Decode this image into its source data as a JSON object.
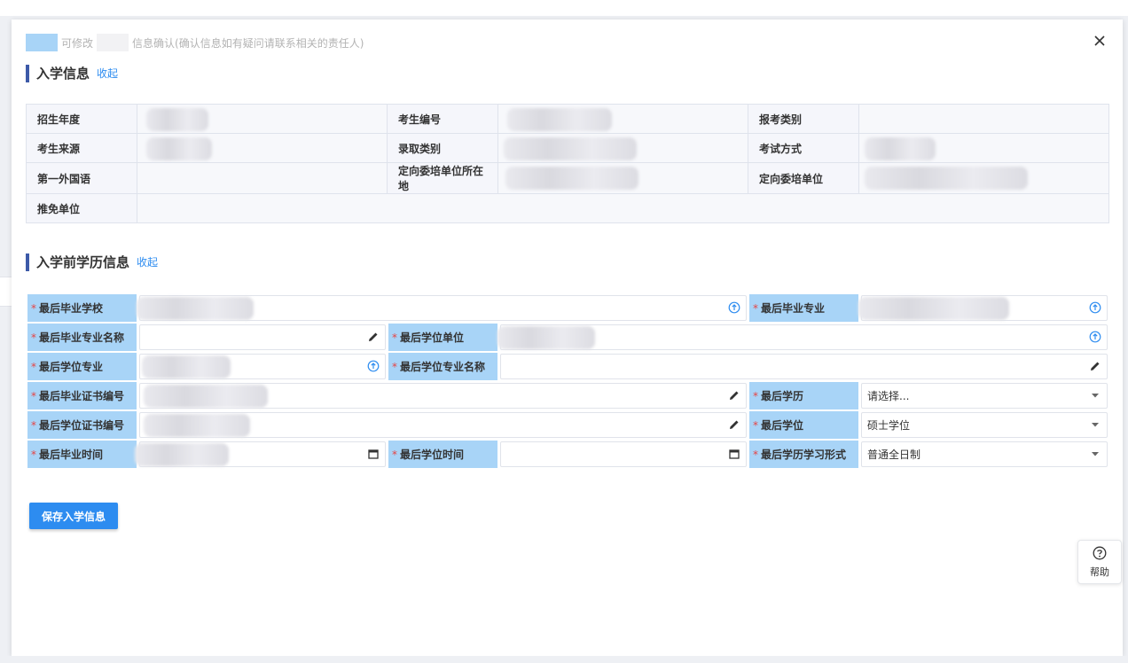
{
  "legend": {
    "modifiable": "可修改",
    "confirm": "信息确认(确认信息如有疑问请联系相关的责任人)"
  },
  "icons": {
    "close": "close-icon",
    "add": "circle-plus-icon",
    "edit": "pencil-icon",
    "calendar": "calendar-icon",
    "dropdown": "caret-down-icon",
    "help": "question-circle-icon"
  },
  "colors": {
    "accent": "#2d8cf0",
    "label_blue": "#a8d4f7",
    "section_bar": "#3d5aa8",
    "required": "#e64545"
  },
  "admission": {
    "title": "入学信息",
    "toggle": "收起",
    "labels": {
      "year": "招生年度",
      "exam_no": "考生编号",
      "category": "报考类别",
      "source": "考生来源",
      "admit_type": "录取类别",
      "exam_mode": "考试方式",
      "foreign_lang": "第一外国语",
      "unit_location": "定向委培单位所在地",
      "unit": "定向委培单位",
      "recommend_unit": "推免单位"
    }
  },
  "education": {
    "title": "入学前学历信息",
    "toggle": "收起",
    "labels": {
      "school": "最后毕业学校",
      "major": "最后毕业专业",
      "major_name": "最后毕业专业名称",
      "degree_unit": "最后学位单位",
      "degree_major": "最后学位专业",
      "degree_major_name": "最后学位专业名称",
      "grad_cert": "最后毕业证书编号",
      "edu_level": "最后学历",
      "degree_cert": "最后学位证书编号",
      "degree": "最后学位",
      "grad_time": "最后毕业时间",
      "degree_time": "最后学位时间",
      "study_form": "最后学历学习形式"
    },
    "values": {
      "edu_level": "请选择...",
      "degree": "硕士学位",
      "study_form": "普通全日制"
    }
  },
  "save_button": "保存入学信息",
  "help": "帮助"
}
